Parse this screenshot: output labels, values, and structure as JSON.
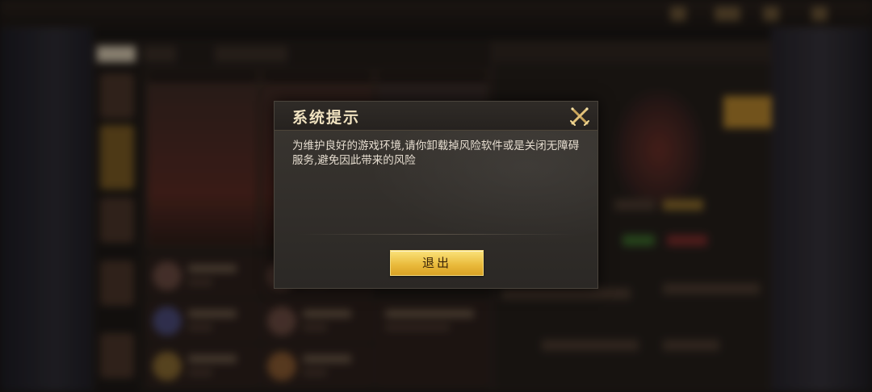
{
  "dialog": {
    "title": "系统提示",
    "message": "为维护良好的游戏环境,请你卸载掉风险软件或是关闭无障碍服务,避免因此带来的风险",
    "exit_button_label": "退出",
    "close_icon": "crossed-swords-close-icon"
  },
  "colors": {
    "accent_gold": "#e9b93a",
    "title_text": "#f0e2c0",
    "dialog_bg": "#33302b"
  }
}
